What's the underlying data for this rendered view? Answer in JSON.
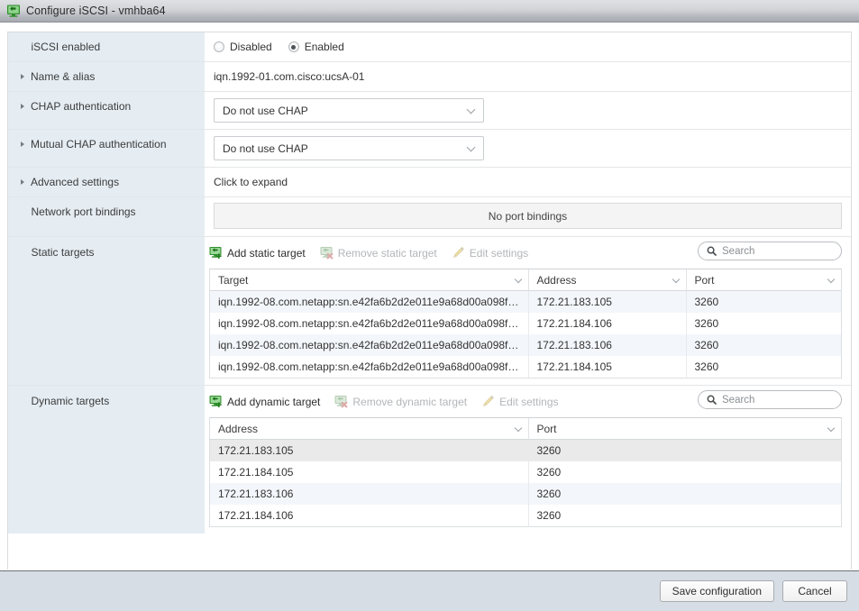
{
  "window": {
    "title": "Configure iSCSI - vmhba64",
    "icon": "iscsi-adapter-icon"
  },
  "form": {
    "rows": [
      {
        "label": "iSCSI enabled",
        "type": "radio",
        "options": [
          {
            "label": "Disabled",
            "checked": false
          },
          {
            "label": "Enabled",
            "checked": true
          }
        ]
      },
      {
        "label": "Name & alias",
        "type": "text",
        "expandable": true,
        "value": "iqn.1992-01.com.cisco:ucsA-01"
      },
      {
        "label": "CHAP authentication",
        "type": "select",
        "expandable": true,
        "value": "Do not use CHAP"
      },
      {
        "label": "Mutual CHAP authentication",
        "type": "select",
        "expandable": true,
        "value": "Do not use CHAP"
      },
      {
        "label": "Advanced settings",
        "type": "link",
        "expandable": true,
        "value": "Click to expand"
      },
      {
        "label": "Network port bindings",
        "type": "empty-box",
        "value": "No port bindings"
      }
    ]
  },
  "static_targets": {
    "label": "Static targets",
    "toolbar": {
      "add": {
        "label": "Add static target",
        "icon": "add-target-icon",
        "enabled": true
      },
      "remove": {
        "label": "Remove static target",
        "icon": "remove-target-icon",
        "enabled": false
      },
      "edit": {
        "label": "Edit settings",
        "icon": "pencil-icon",
        "enabled": false
      }
    },
    "search": {
      "placeholder": "Search",
      "value": "",
      "icon": "search-icon"
    },
    "columns": [
      "Target",
      "Address",
      "Port"
    ],
    "rows": [
      [
        "iqn.1992-08.com.netapp:sn.e42fa6b2d2e011e9a68d00a098f…",
        "172.21.183.105",
        "3260"
      ],
      [
        "iqn.1992-08.com.netapp:sn.e42fa6b2d2e011e9a68d00a098f…",
        "172.21.184.106",
        "3260"
      ],
      [
        "iqn.1992-08.com.netapp:sn.e42fa6b2d2e011e9a68d00a098f…",
        "172.21.183.106",
        "3260"
      ],
      [
        "iqn.1992-08.com.netapp:sn.e42fa6b2d2e011e9a68d00a098f…",
        "172.21.184.105",
        "3260"
      ]
    ]
  },
  "dynamic_targets": {
    "label": "Dynamic targets",
    "toolbar": {
      "add": {
        "label": "Add dynamic target",
        "icon": "add-target-icon",
        "enabled": true
      },
      "remove": {
        "label": "Remove dynamic target",
        "icon": "remove-target-icon",
        "enabled": false
      },
      "edit": {
        "label": "Edit settings",
        "icon": "pencil-icon",
        "enabled": false
      }
    },
    "search": {
      "placeholder": "Search",
      "value": "",
      "icon": "search-icon"
    },
    "columns": [
      "Address",
      "Port"
    ],
    "rows": [
      [
        "172.21.183.105",
        "3260"
      ],
      [
        "172.21.184.105",
        "3260"
      ],
      [
        "172.21.183.106",
        "3260"
      ],
      [
        "172.21.184.106",
        "3260"
      ]
    ]
  },
  "footer": {
    "save_label": "Save configuration",
    "cancel_label": "Cancel"
  },
  "colors": {
    "label_bg": "#e5edf3",
    "row_alt": "#f3f6fa",
    "footer_bg": "#d7dde4",
    "accent_green": "#3a9a36"
  }
}
